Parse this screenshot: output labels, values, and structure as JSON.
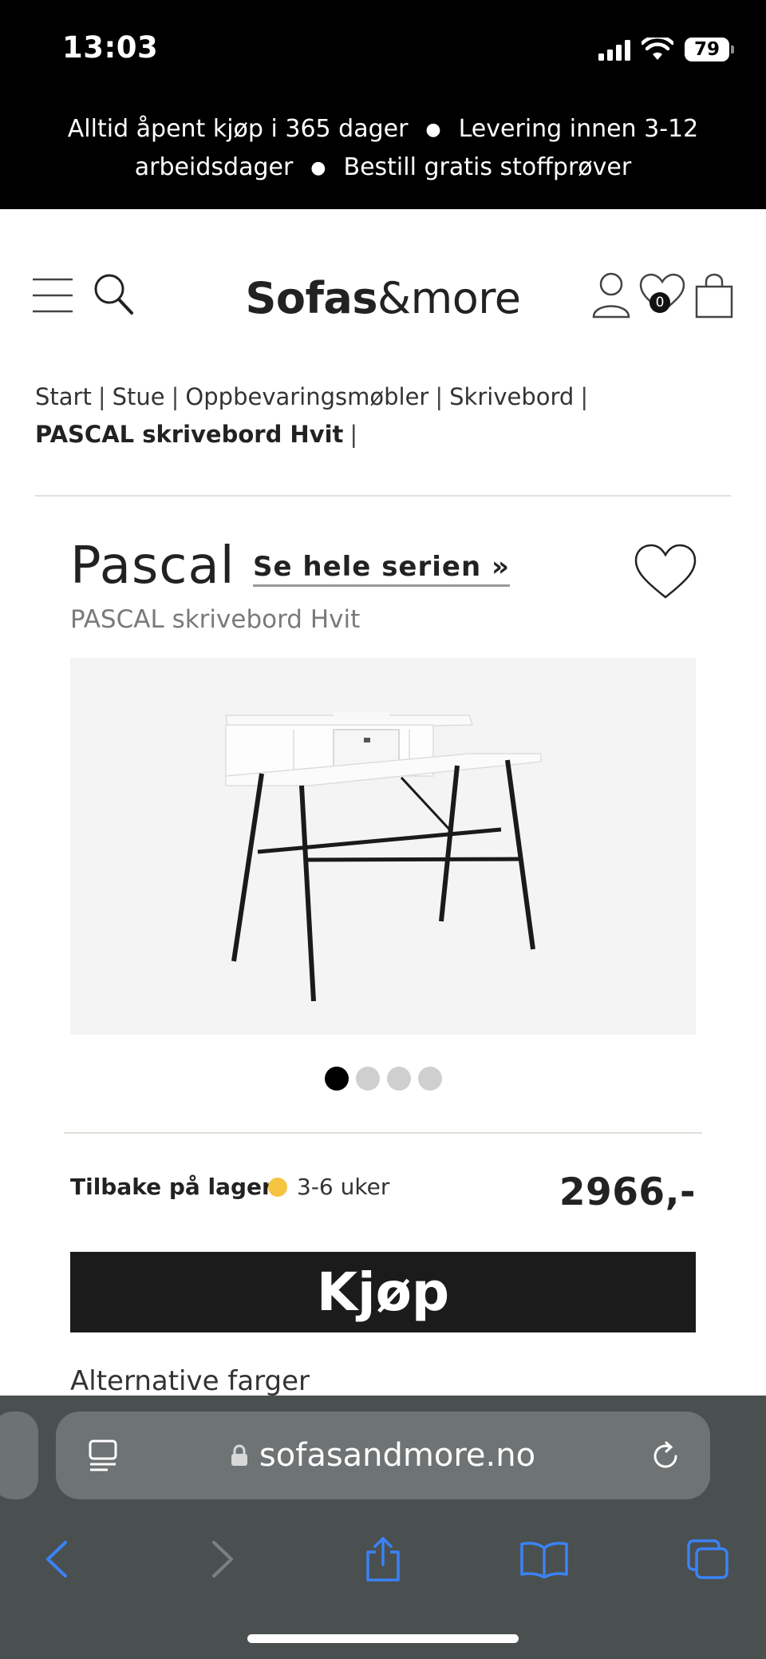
{
  "status": {
    "time": "13:03",
    "battery": "79"
  },
  "announcement": {
    "item1": "Alltid åpent kjøp i 365 dager",
    "item2": "Levering innen 3-12 arbeidsdager",
    "item3": "Bestill gratis stoffprøver",
    "separator": "●"
  },
  "header": {
    "logo_bold": "Sofas",
    "logo_rest": "&more",
    "wishlist_count": "0"
  },
  "breadcrumb": {
    "items": [
      "Start",
      "Stue",
      "Oppbevaringsmøbler",
      "Skrivebord"
    ],
    "current": "PASCAL skrivebord Hvit",
    "separator": "|"
  },
  "product": {
    "series": "Pascal",
    "series_link": "Se hele serien »",
    "subtitle": "PASCAL skrivebord Hvit",
    "image_count": 4,
    "active_image": 1,
    "stock_label": "Tilbake på lager:",
    "stock_value": "3-6 uker",
    "stock_color": "#f5c542",
    "price": "2966,-",
    "buy_label": "Kjøp",
    "alt_colors_label": "Alternative farger"
  },
  "browser": {
    "url": "sofasandmore.no",
    "accent": "#3b82f6"
  }
}
